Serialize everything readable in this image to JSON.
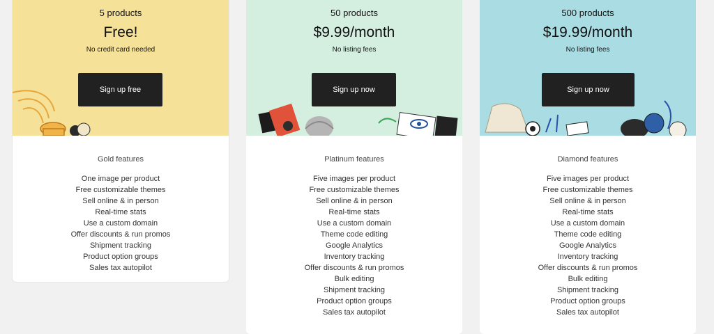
{
  "plans": [
    {
      "products": "5 products",
      "price": "Free!",
      "note": "No credit card needed",
      "cta": "Sign up free",
      "features_title": "Gold features",
      "features": [
        "One image per product",
        "Free customizable themes",
        "Sell online & in person",
        "Real-time stats",
        "Use a custom domain",
        "Offer discounts & run promos",
        "Shipment tracking",
        "Product option groups",
        "Sales tax autopilot"
      ]
    },
    {
      "products": "50 products",
      "price": "$9.99/month",
      "note": "No listing fees",
      "cta": "Sign up now",
      "features_title": "Platinum features",
      "features": [
        "Five images per product",
        "Free customizable themes",
        "Sell online & in person",
        "Real-time stats",
        "Use a custom domain",
        "Theme code editing",
        "Google Analytics",
        "Inventory tracking",
        "Offer discounts & run promos",
        "Bulk editing",
        "Shipment tracking",
        "Product option groups",
        "Sales tax autopilot"
      ]
    },
    {
      "products": "500 products",
      "price": "$19.99/month",
      "note": "No listing fees",
      "cta": "Sign up now",
      "features_title": "Diamond features",
      "features": [
        "Five images per product",
        "Free customizable themes",
        "Sell online & in person",
        "Real-time stats",
        "Use a custom domain",
        "Theme code editing",
        "Google Analytics",
        "Inventory tracking",
        "Offer discounts & run promos",
        "Bulk editing",
        "Shipment tracking",
        "Product option groups",
        "Sales tax autopilot"
      ]
    }
  ],
  "colors": {
    "gold_bg": "#f6e199",
    "platinum_bg": "#d4eee0",
    "diamond_bg": "#a9dde3",
    "button_bg": "#212121",
    "page_bg": "#f1f1f1"
  }
}
